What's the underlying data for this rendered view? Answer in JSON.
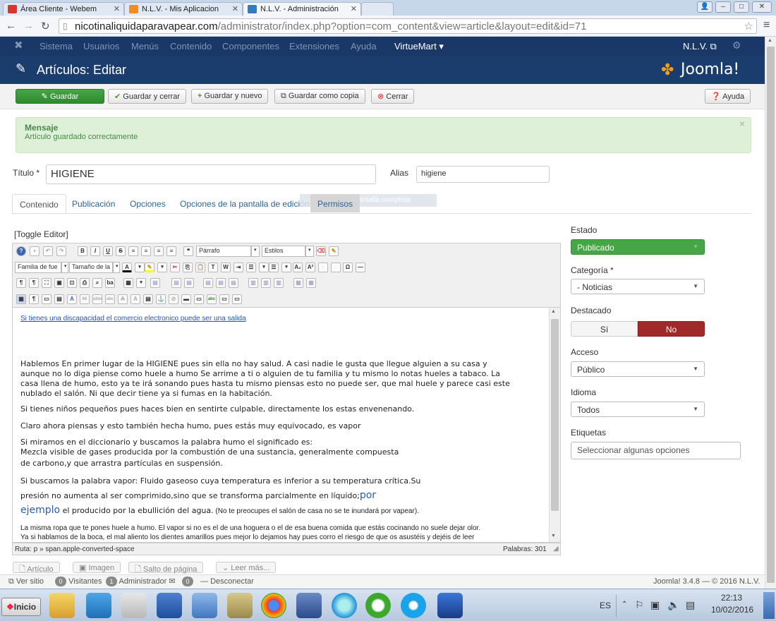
{
  "browser": {
    "tabs": [
      {
        "title": "Área Cliente - Webem",
        "color": "#d9352a"
      },
      {
        "title": "N.L.V. - Mis Aplicacion",
        "color": "#f28c1e"
      },
      {
        "title": "N.L.V. - Administración",
        "color": "#2f7cc2"
      }
    ],
    "url_host": "nicotinaliquidaparavapear.com",
    "url_path": "/administrator/index.php?option=com_content&view=article&layout=edit&id=71"
  },
  "joomla": {
    "menu": [
      "Sistema",
      "Usuarios",
      "Menús",
      "Contenido",
      "Componentes",
      "Extensiones",
      "Ayuda",
      "VirtueMart ▾"
    ],
    "site_link": "N.L.V. ⧉",
    "page_title": "Artículos: Editar",
    "brand": "Joomla!",
    "toolbar": {
      "save": "Guardar",
      "save_close": "Guardar y cerrar",
      "save_new": "Guardar y nuevo",
      "save_copy": "Guardar como copia",
      "close": "Cerrar",
      "help": "Ayuda"
    },
    "message": {
      "title": "Mensaje",
      "text": "Artículo guardado correctamente"
    },
    "form": {
      "title_label": "Título *",
      "title_value": "HIGIENE",
      "alias_label": "Alias",
      "alias_value": "higiene"
    },
    "tabs": [
      "Contenido",
      "Publicación",
      "Opciones",
      "Opciones de la pantalla de edición",
      "Permisos"
    ],
    "tooltip_fragment": "pantalla completa",
    "editor": {
      "toggle": "[Toggle Editor]",
      "format_select": "Párrafo",
      "styles_select": "Estilos",
      "font_family": "Familia de fue",
      "font_size": "Tamaño de la",
      "link": "Si tienes una discapacidad el comercio electronico puede ser una salida",
      "para1": [
        "Hablemos En primer lugar de la HIGIENE pues sin ella no hay salud. A casi nadie le gusta que llegue alguien a su casa y",
        "aunque no lo diga piense como huele a humo Se arrime a ti o alguien de tu familia y tu mismo lo notas hueles a tabaco. La",
        "casa llena de humo, esto ya te irá sonando pues hasta tu mismo piensas esto no puede ser, que mal huele y parece casi este",
        "nublado el salón. Ni que decir tiene ya si fumas en la habitación."
      ],
      "para2": "Si tienes niños pequeños pues haces bien en sentirte culpable, directamente los estas envenenando.",
      "para3": "Claro ahora piensas y esto también hecha humo, pues estás muy equivocado, es vapor",
      "para4": [
        "Si miramos en el diccionario  y buscamos la palabra humo el significado es:",
        "Mezcla visible de gases producida por la combustión de una sustancia, generalmente compuesta",
        "  de carbono,y que arrastra partículas en suspensión."
      ],
      "para5a": "Si  buscamos la palabra vapor: Fluido  gaseoso  cuya  temperatura  es inferior  a  su  temperatura crítica.Su",
      "para5b": " presión no aumenta al ser comprimido,sino que se transforma parcialmente en líquido;",
      "para5b_big": "por",
      "para5c_big": "ejemplo",
      "para5c": "  el producido por la ebullición  del  agua.",
      "para5c_small": " (No te preocupes el salón de casa no se te inundará por vapear).",
      "para6": [
        "La misma ropa que te pones huele a humo. El vapor si no es el de una hoguera o el de esa buena comida que estás cocinando no suele dejar olor.",
        "Ya si hablamos de la boca, el mal aliento los dientes amarillos pues mejor lo dejamos hay pues corro el riesgo de que os asustéis y dejéis de leer"
      ],
      "path": "Ruta:  p » span.apple-converted-space",
      "words": "Palabras: 301"
    },
    "bottom_buttons": [
      "Artículo",
      "Imagen",
      "Salto de página",
      "Leer más..."
    ],
    "sidebar": {
      "estado_label": "Estado",
      "estado_value": "Publicado",
      "categoria_label": "Categoría *",
      "categoria_value": "- Noticias",
      "destacado_label": "Destacado",
      "destacado_yes": "Sí",
      "destacado_no": "No",
      "acceso_label": "Acceso",
      "acceso_value": "Público",
      "idioma_label": "Idioma",
      "idioma_value": "Todos",
      "etiquetas_label": "Etiquetas",
      "etiquetas_placeholder": "Seleccionar algunas opciones"
    },
    "footer": {
      "view_site": "Ver sitio",
      "visitors_count": "0",
      "visitors": "Visitantes",
      "admin_count": "1",
      "admin": "Administrador",
      "msg_count": "0",
      "logout": "Desconectar",
      "version": "Joomla! 3.4.8 — © 2016 N.L.V."
    }
  },
  "taskbar": {
    "start": "Inicio",
    "lang": "ES",
    "time": "22:13",
    "date": "10/02/2016"
  }
}
